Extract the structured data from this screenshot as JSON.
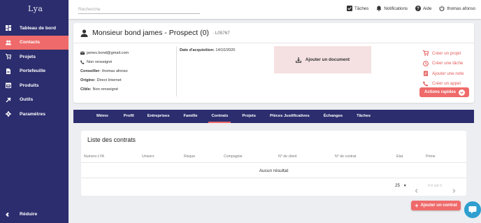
{
  "app": {
    "logo": "Lya"
  },
  "sidebar": {
    "items": [
      {
        "label": "Tableau de bord",
        "icon": "dashboard-icon"
      },
      {
        "label": "Contacts",
        "icon": "people-icon",
        "active": true
      },
      {
        "label": "Projets",
        "icon": "cart-icon"
      },
      {
        "label": "Portefeuille",
        "icon": "document-icon"
      },
      {
        "label": "Produits",
        "icon": "store-icon"
      },
      {
        "label": "Outils",
        "icon": "tools-icon"
      },
      {
        "label": "Paramètres",
        "icon": "gear-icon"
      }
    ],
    "reduce_label": "Réduire"
  },
  "topbar": {
    "search_placeholder": "Recherche",
    "tasks_label": "Tâches",
    "notifications_label": "Notifications",
    "help_label": "Aide",
    "user_label": "thomas afonso"
  },
  "contact": {
    "title": "Monsieur bond james - Prospect (0)",
    "id": "· L05767",
    "email": "james.bond@gmail.com",
    "phone": "Non renseigné",
    "advisor_label": "Conseiller:",
    "advisor": "thomas afonso",
    "origin_label": "Origine:",
    "origin": "Direct Internet",
    "target_label": "Cible:",
    "target": "Non renseigné",
    "acquisition_label": "Date d'acquisition:",
    "acquisition_date": "14/10/2020",
    "add_document_label": "Ajouter un document"
  },
  "actions": {
    "items": [
      {
        "label": "Créer un projet",
        "icon": "cart-icon"
      },
      {
        "label": "Créer une tâche",
        "icon": "clock-icon"
      },
      {
        "label": "Ajouter une note",
        "icon": "note-icon"
      },
      {
        "label": "Créer un appel",
        "icon": "phone-icon"
      }
    ],
    "quick_actions_label": "Actions rapides"
  },
  "tabs": [
    {
      "label": "Mémo"
    },
    {
      "label": "Profil"
    },
    {
      "label": "Entreprises"
    },
    {
      "label": "Famille"
    },
    {
      "label": "Contrats",
      "active": true
    },
    {
      "label": "Projets"
    },
    {
      "label": "Pièces Justificatives"
    },
    {
      "label": "Échanges"
    },
    {
      "label": "Tâches"
    }
  ],
  "contracts": {
    "title": "Liste des contrats",
    "columns": [
      "Numero LYA",
      "Univers",
      "Risque",
      "Compagnie",
      "N° de client",
      "N° de contrat",
      "Etat",
      "Prime"
    ],
    "empty_message": "Aucun résultat",
    "rows_per_page": "25",
    "page_info": "0-0 out 0",
    "add_button_label": "Ajouter un contrat"
  },
  "colors": {
    "sidebar": "#2c2d6e",
    "accent": "#ef6a6a",
    "chat": "#2f9fd0"
  }
}
